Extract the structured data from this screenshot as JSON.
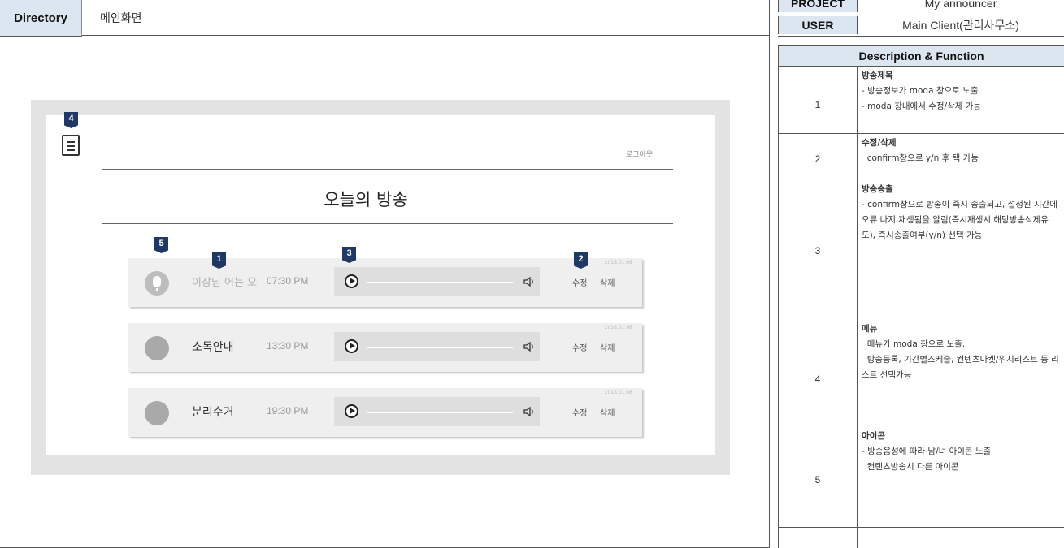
{
  "header": {
    "directory_label": "Directory",
    "directory_value": "메인화면",
    "project_label": "PROJECT",
    "project_value": "My announcer",
    "user_label": "USER",
    "user_value": "Main Client(관리사무소)"
  },
  "mockup": {
    "logout": "로그아웃",
    "title": "오늘의 방송",
    "menu_marker": "4",
    "cards": [
      {
        "title": "이장님 어는 오",
        "time": "07:30 PM",
        "date": "2018.01.08",
        "edit": "수정",
        "delete": "삭제"
      },
      {
        "title": "소독안내",
        "time": "13:30 PM",
        "date": "2018.01.08",
        "edit": "수정",
        "delete": "삭제"
      },
      {
        "title": "분리수거",
        "time": "19:30 PM",
        "date": "2018.01.08",
        "edit": "수정",
        "delete": "삭제"
      }
    ],
    "markers": {
      "avatar": "5",
      "title": "1",
      "player": "3",
      "edit": "2"
    }
  },
  "description": {
    "header": "Description & Function",
    "rows": [
      {
        "num": "1",
        "title": "방송제목",
        "body": "- 방송정보가 moda 창으로 노출\n- moda 창내에서 수정/삭제 가능"
      },
      {
        "num": "2",
        "title": "수정/삭제",
        "body": "  confirm창으로 y/n 후 택 가능"
      },
      {
        "num": "3",
        "title": "방송송출",
        "body": "- confirm창으로 방송이 즉시 송출되고, 설정된 시간에 오류 나지 재생됨을 알림(즉시재생시 해당방송삭제유도), 즉시송출여부(y/n) 선택 가능"
      },
      {
        "num": "4",
        "title": "메뉴",
        "body": "  메뉴가 moda 창으로 노출.\n  방송등록, 기간별스케줄, 컨텐츠마켓/위시리스트 등 리스트 선택가능"
      },
      {
        "num": "5",
        "title": "아이콘",
        "body": "- 방송음성에 따라 남/녀 아이콘 노출\n  컨텐츠방송시 다른 아이콘"
      }
    ]
  }
}
